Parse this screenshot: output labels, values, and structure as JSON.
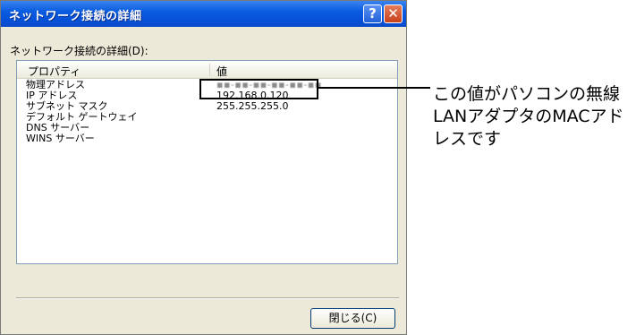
{
  "window": {
    "title": "ネットワーク接続の詳細",
    "help_label": "?",
    "close_label": "✕"
  },
  "group_label": "ネットワーク接続の詳細(D):",
  "table": {
    "columns": [
      "プロパティ",
      "値"
    ],
    "rows": [
      {
        "property": "物理アドレス",
        "value": "▪▪-▪▪-▪▪-▪▪-▪▪-▪▪"
      },
      {
        "property": "IP アドレス",
        "value": "192.168.0.120"
      },
      {
        "property": "サブネット マスク",
        "value": "255.255.255.0"
      },
      {
        "property": "デフォルト ゲートウェイ",
        "value": ""
      },
      {
        "property": "DNS サーバー",
        "value": ""
      },
      {
        "property": "WINS サーバー",
        "value": ""
      }
    ]
  },
  "buttons": {
    "close": "閉じる(C)"
  },
  "annotation": "この値がパソコンの無線LANアダプタのMACアドレスです"
}
